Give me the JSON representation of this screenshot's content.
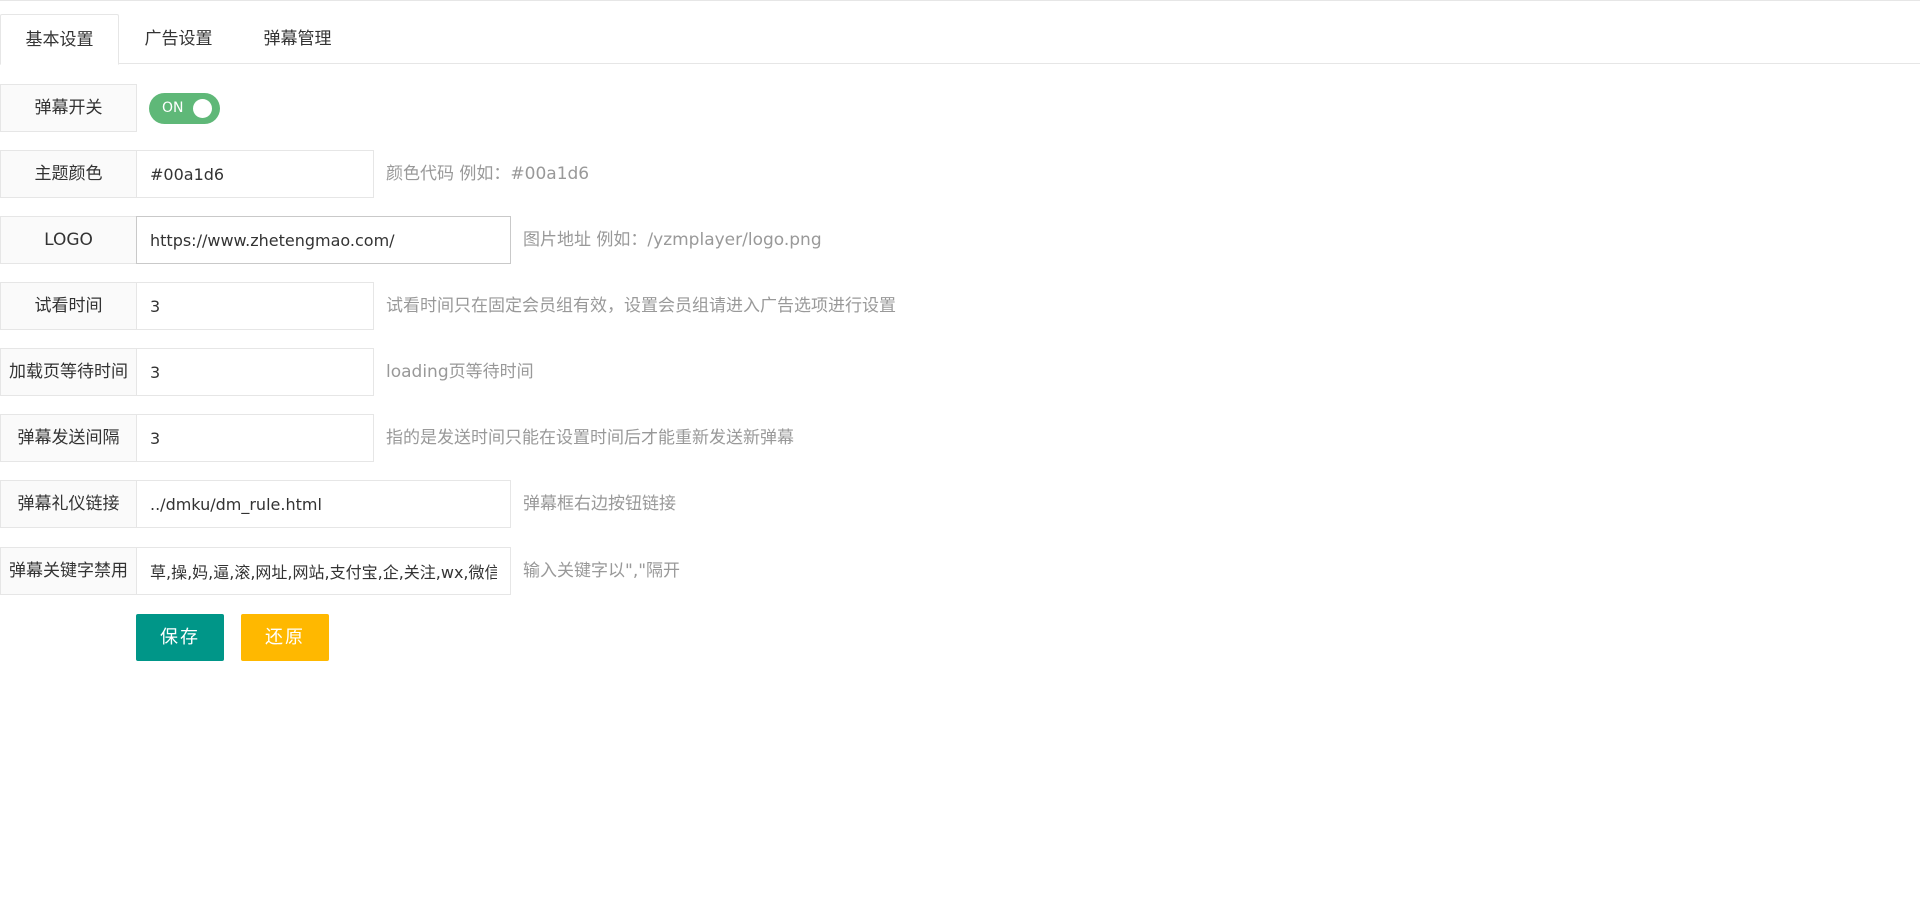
{
  "tabs": [
    {
      "label": "基本设置",
      "active": true
    },
    {
      "label": "广告设置",
      "active": false
    },
    {
      "label": "弹幕管理",
      "active": false
    }
  ],
  "form": {
    "danmu_switch": {
      "label": "弹幕开关",
      "state": "ON",
      "color": "#5fb878"
    },
    "theme_color": {
      "label": "主题颜色",
      "value": "#00a1d6",
      "hint": "颜色代码 例如：#00a1d6"
    },
    "logo": {
      "label": "LOGO",
      "value": "https://www.zhetengmao.com/",
      "hint": "图片地址 例如：/yzmplayer/logo.png"
    },
    "trial_time": {
      "label": "试看时间",
      "value": "3",
      "hint": "试看时间只在固定会员组有效，设置会员组请进入广告选项进行设置"
    },
    "loading_wait": {
      "label": "加载页等待时间",
      "value": "3",
      "hint": "loading页等待时间"
    },
    "send_interval": {
      "label": "弹幕发送间隔",
      "value": "3",
      "hint": "指的是发送时间只能在设置时间后才能重新发送新弹幕"
    },
    "etiquette_link": {
      "label": "弹幕礼仪链接",
      "value": "../dmku/dm_rule.html",
      "hint": "弹幕框右边按钮链接"
    },
    "keyword_ban": {
      "label": "弹幕关键字禁用",
      "value": "草,操,妈,逼,滚,网址,网站,支付宝,企,关注,wx,微信",
      "hint": "输入关键字以\",\"隔开"
    }
  },
  "buttons": {
    "save_label": "保存",
    "reset_label": "还原",
    "save_color": "#009688",
    "reset_color": "#ffb800"
  }
}
